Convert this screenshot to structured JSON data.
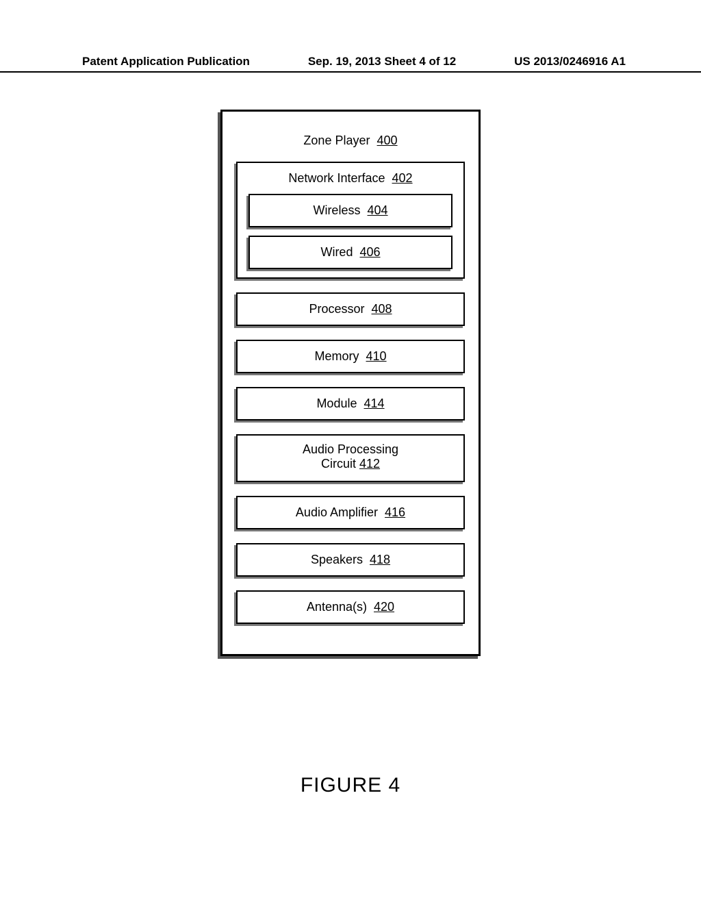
{
  "header": {
    "left": "Patent Application Publication",
    "center": "Sep. 19, 2013  Sheet 4 of 12",
    "right": "US 2013/0246916 A1"
  },
  "diagram": {
    "title_label": "Zone Player",
    "title_ref": "400",
    "network": {
      "label": "Network Interface",
      "ref": "402",
      "wireless_label": "Wireless",
      "wireless_ref": "404",
      "wired_label": "Wired",
      "wired_ref": "406"
    },
    "blocks": [
      {
        "label": "Processor",
        "ref": "408"
      },
      {
        "label": "Memory",
        "ref": "410"
      },
      {
        "label": "Module",
        "ref": "414"
      },
      {
        "label": "Audio Processing Circuit",
        "ref": "412",
        "multiline": true
      },
      {
        "label": "Audio Amplifier",
        "ref": "416"
      },
      {
        "label": "Speakers",
        "ref": "418"
      },
      {
        "label": "Antenna(s)",
        "ref": "420"
      }
    ]
  },
  "caption": "FIGURE 4"
}
